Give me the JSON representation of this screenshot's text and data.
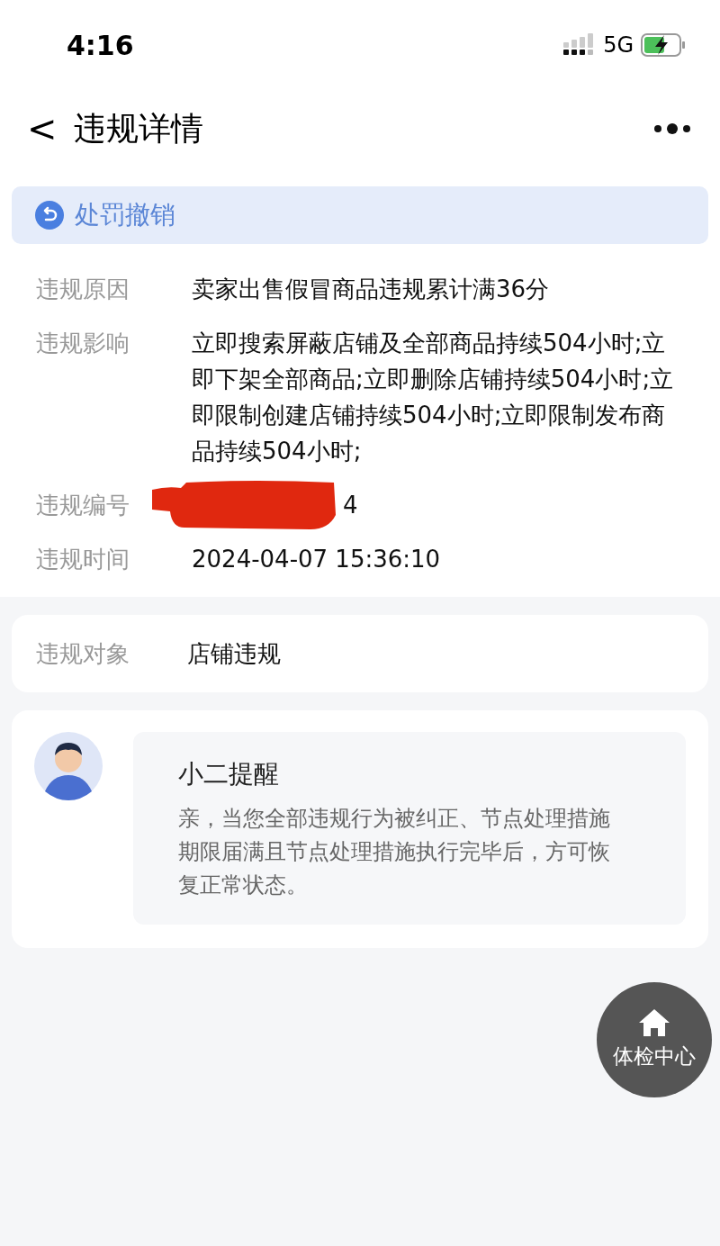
{
  "status_bar": {
    "time": "4:16",
    "network": "5G"
  },
  "nav": {
    "back": "<",
    "title": "违规详情"
  },
  "banner": {
    "label": "处罚撤销"
  },
  "details": [
    {
      "label": "违规原因",
      "value": "卖家出售假冒商品违规累计满36分",
      "redacted": false
    },
    {
      "label": "违规影响",
      "value": "立即搜索屏蔽店铺及全部商品持续504小时;立即下架全部商品;立即删除店铺持续504小时;立即限制创建店铺持续504小时;立即限制发布商品持续504小时;",
      "redacted": false
    },
    {
      "label": "违规编号",
      "value": "4",
      "redacted": true
    },
    {
      "label": "违规时间",
      "value": "2024-04-07 15:36:10",
      "redacted": false
    }
  ],
  "target": {
    "label": "违规对象",
    "value": "店铺违规"
  },
  "reminder": {
    "title": "小二提醒",
    "body": "亲，当您全部违规行为被纠正、节点处理措施期限届满且节点处理措施执行完毕后，方可恢复正常状态。"
  },
  "fab": {
    "label": "体检中心"
  }
}
